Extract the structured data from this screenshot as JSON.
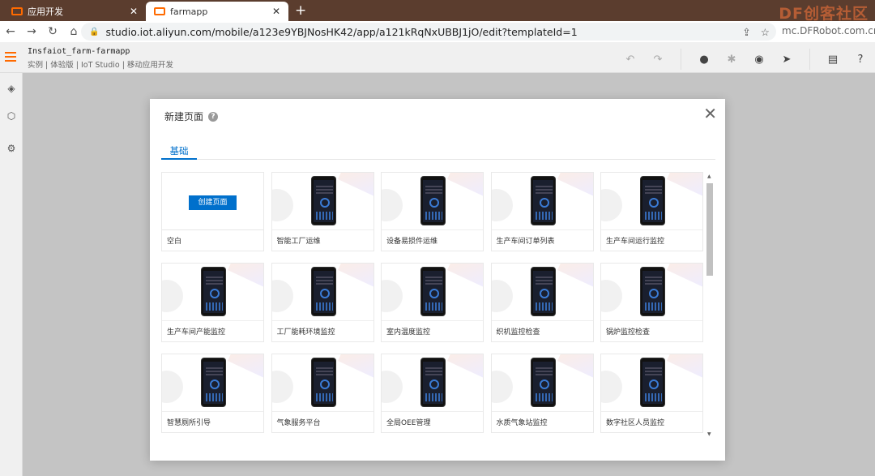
{
  "browser": {
    "tabs": [
      {
        "title": "应用开发",
        "close": "✕"
      },
      {
        "title": "farmapp",
        "close": "✕"
      }
    ],
    "new_tab": "+",
    "url": "studio.iot.aliyun.com/mobile/a123e9YBJNosHK42/app/a121kRqNxUBBJ1jO/edit?templateId=1",
    "watermark": "DF创客社区",
    "watermark_url": "mc.DFRobot.com.cn",
    "nav": {
      "back": "←",
      "forward": "→",
      "reload": "↻",
      "home": "⌂"
    },
    "lock": "🔒",
    "omnibox_icons": [
      "⇪",
      "☆"
    ]
  },
  "app": {
    "title": "Insfaiot_farm-farmapp",
    "breadcrumb": "实例 | 体验版 | IoT Studio | 移动应用开发",
    "toolbar_icons": [
      "undo-icon",
      "redo-icon",
      "check-icon",
      "bug-icon",
      "eye-icon",
      "send-icon",
      "doc-icon",
      "help-icon"
    ],
    "toolbar_glyphs": [
      "↶",
      "↷",
      "●",
      "✱",
      "◉",
      "➤",
      "▤",
      "?"
    ]
  },
  "rail": {
    "glyphs": [
      "◈",
      "⬡",
      "⚙"
    ]
  },
  "modal": {
    "title": "新建页面",
    "help": "?",
    "close": "✕",
    "tab": "基础",
    "create_button": "创建页面",
    "templates": [
      {
        "label": "空白",
        "blank": true
      },
      {
        "label": "智能工厂运维"
      },
      {
        "label": "设备易损件运维"
      },
      {
        "label": "生产车间订单列表"
      },
      {
        "label": "生产车间运行监控"
      },
      {
        "label": "生产车间产能监控"
      },
      {
        "label": "工厂能耗环境监控"
      },
      {
        "label": "室内温度监控"
      },
      {
        "label": "织机监控检查"
      },
      {
        "label": "锅炉监控检查"
      },
      {
        "label": "智慧厕所引导"
      },
      {
        "label": "气象服务平台"
      },
      {
        "label": "全局OEE管理"
      },
      {
        "label": "水质气象站监控"
      },
      {
        "label": "数字社区人员监控"
      }
    ],
    "scroll_up": "▲",
    "scroll_down": "▼"
  }
}
